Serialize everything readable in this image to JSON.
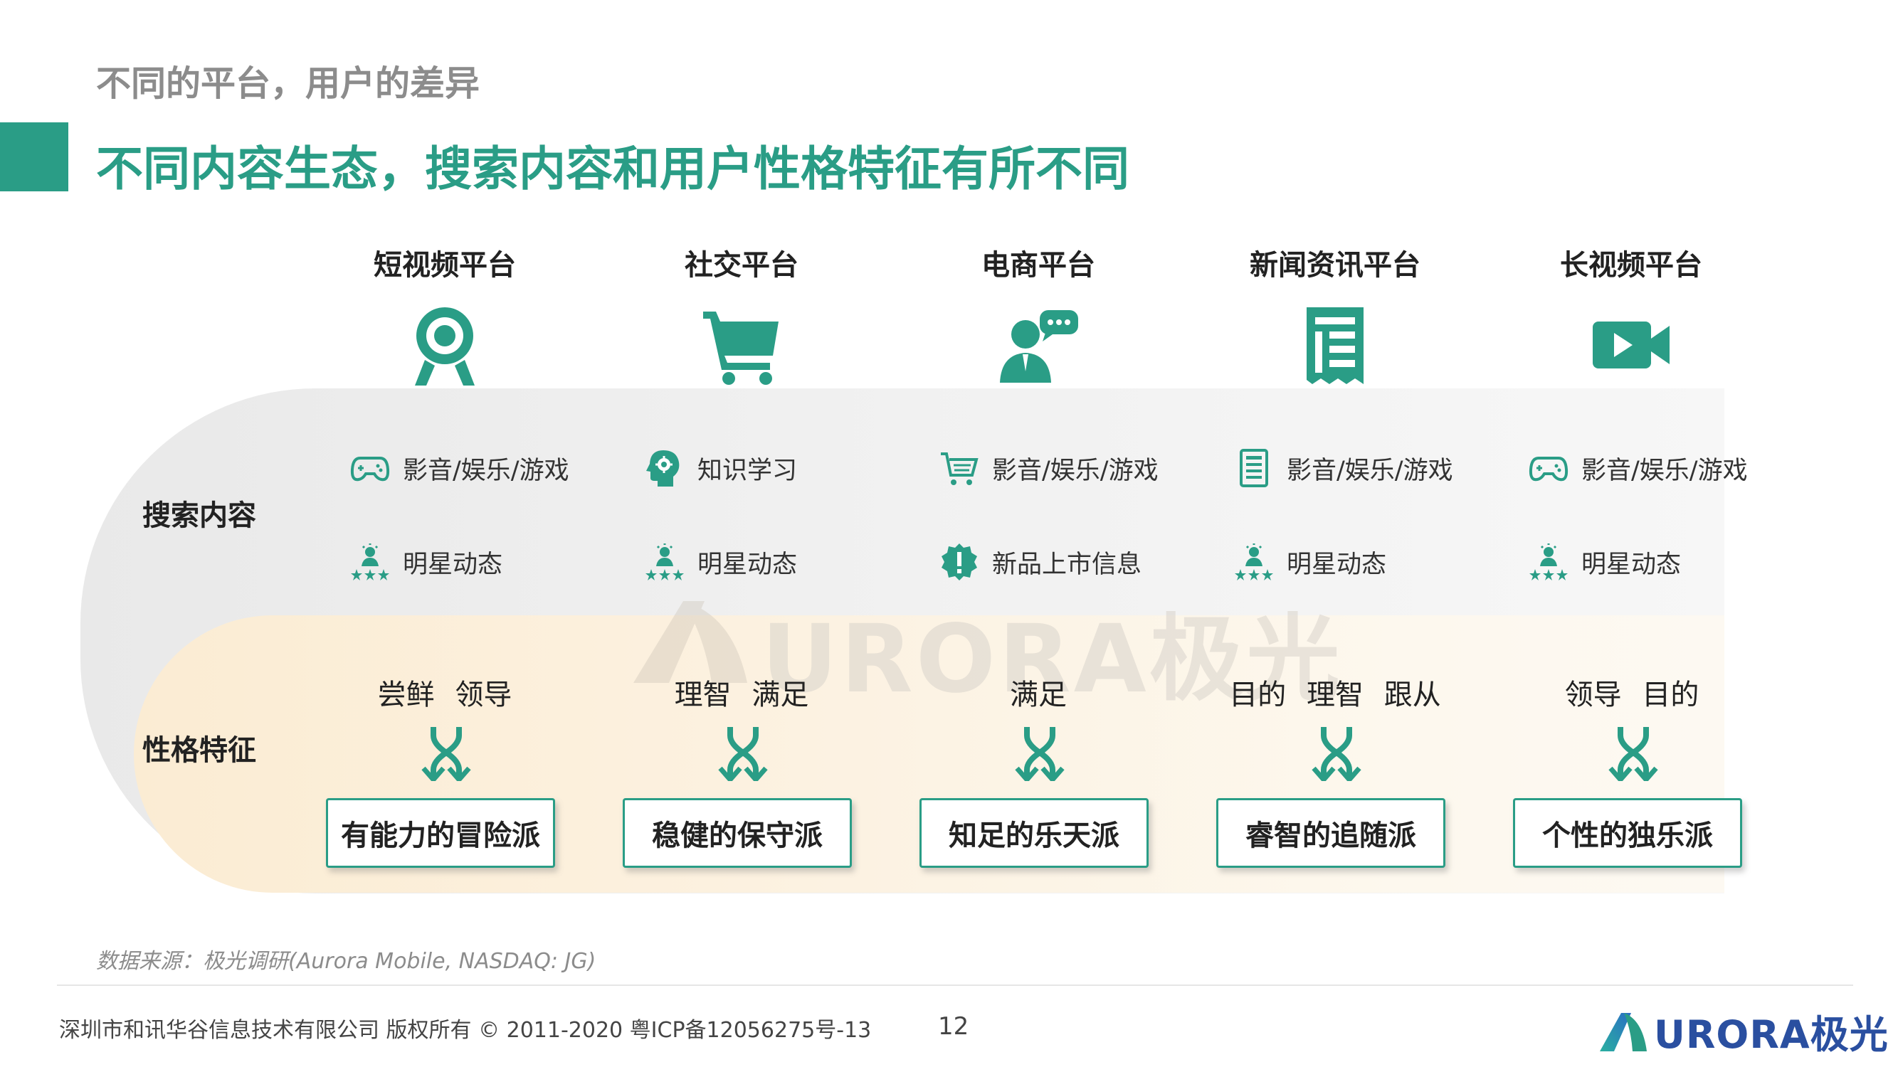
{
  "header": {
    "subtitle": "不同的平台，用户的差异",
    "headline": "不同内容生态，搜索内容和用户性格特征有所不同"
  },
  "platforms": [
    {
      "name": "短视频平台",
      "icon": "webcam-icon"
    },
    {
      "name": "社交平台",
      "icon": "shopping-cart-icon"
    },
    {
      "name": "电商平台",
      "icon": "customer-service-icon"
    },
    {
      "name": "新闻资讯平台",
      "icon": "newspaper-icon"
    },
    {
      "name": "长视频平台",
      "icon": "video-camera-icon"
    }
  ],
  "rows": {
    "search_label": "搜索内容",
    "persona_label": "性格特征"
  },
  "search_content": [
    [
      {
        "icon": "gamepad-icon",
        "text": "影音/娱乐/游戏"
      },
      {
        "icon": "star-person-icon",
        "text": "明星动态"
      }
    ],
    [
      {
        "icon": "head-gear-icon",
        "text": "知识学习"
      },
      {
        "icon": "star-person-icon",
        "text": "明星动态"
      }
    ],
    [
      {
        "icon": "cart-icon",
        "text": "影音/娱乐/游戏"
      },
      {
        "icon": "alert-badge-icon",
        "text": "新品上市信息"
      }
    ],
    [
      {
        "icon": "document-icon",
        "text": "影音/娱乐/游戏"
      },
      {
        "icon": "star-person-icon",
        "text": "明星动态"
      }
    ],
    [
      {
        "icon": "gamepad-icon",
        "text": "影音/娱乐/游戏"
      },
      {
        "icon": "star-person-icon",
        "text": "明星动态"
      }
    ]
  ],
  "personas": [
    {
      "traits": "尝鲜 领导",
      "type": "有能力的冒险派"
    },
    {
      "traits": "理智 满足",
      "type": "稳健的保守派"
    },
    {
      "traits": "满足",
      "type": "知足的乐天派"
    },
    {
      "traits": "目的 理智 跟从",
      "type": "睿智的追随派"
    },
    {
      "traits": "领导 目的",
      "type": "个性的独乐派"
    }
  ],
  "watermark": "URORA极光",
  "footer": {
    "source": "数据来源：极光调研(Aurora Mobile, NASDAQ: JG)",
    "copyright": "深圳市和讯华谷信息技术有限公司 版权所有 © 2011-2020 粤ICP备12056275号-13",
    "page_number": "12",
    "brand": "URORA极光"
  },
  "colors": {
    "accent": "#2a9d86",
    "subtitle_gray": "#8c8c8c",
    "persona_band": "#fbecd3",
    "search_band": "#ececec",
    "brand_blue": "#2a4fa0"
  }
}
